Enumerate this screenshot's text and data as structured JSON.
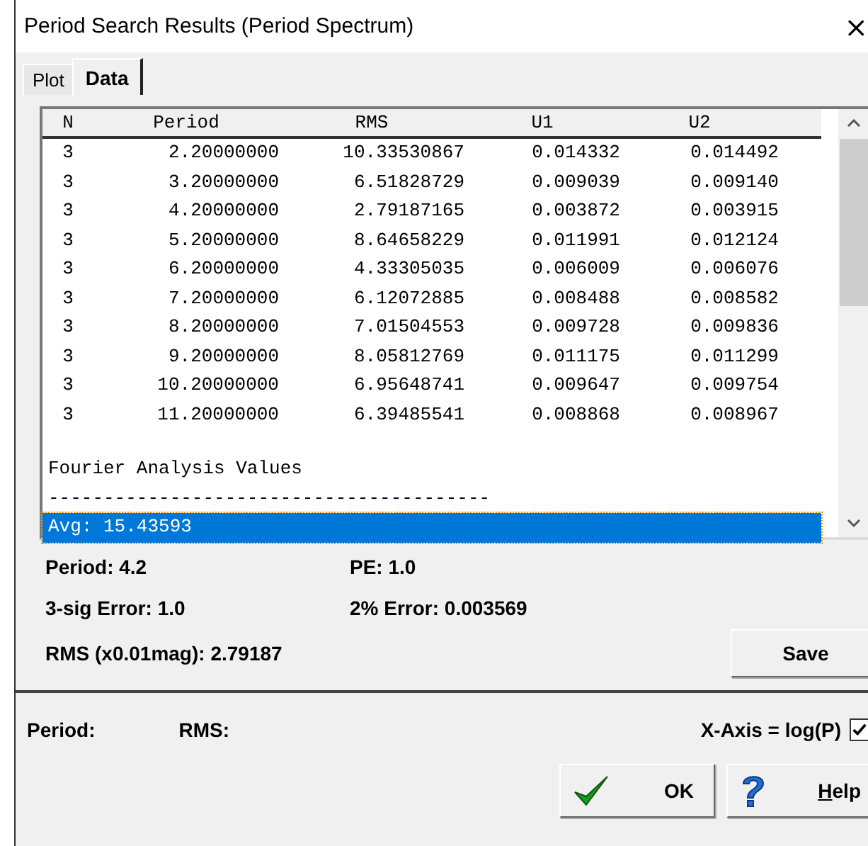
{
  "window": {
    "title": "Period Search Results (Period Spectrum)",
    "close": "×"
  },
  "tabs": [
    {
      "label": "Plot",
      "selected": false
    },
    {
      "label": "Data",
      "selected": true
    }
  ],
  "list": {
    "columns": [
      "N",
      "Period",
      "RMS",
      "U1",
      "U2"
    ],
    "lines": [
      {
        "kind": "row",
        "selected": false,
        "cells": [
          "3",
          "2.20000000",
          "10.33530867",
          "0.014332",
          "0.014492"
        ]
      },
      {
        "kind": "row",
        "selected": false,
        "cells": [
          "3",
          "3.20000000",
          "6.51828729",
          "0.009039",
          "0.009140"
        ]
      },
      {
        "kind": "row",
        "selected": false,
        "cells": [
          "3",
          "4.20000000",
          "2.79187165",
          "0.003872",
          "0.003915"
        ]
      },
      {
        "kind": "row",
        "selected": false,
        "cells": [
          "3",
          "5.20000000",
          "8.64658229",
          "0.011991",
          "0.012124"
        ]
      },
      {
        "kind": "row",
        "selected": false,
        "cells": [
          "3",
          "6.20000000",
          "4.33305035",
          "0.006009",
          "0.006076"
        ]
      },
      {
        "kind": "row",
        "selected": false,
        "cells": [
          "3",
          "7.20000000",
          "6.12072885",
          "0.008488",
          "0.008582"
        ]
      },
      {
        "kind": "row",
        "selected": false,
        "cells": [
          "3",
          "8.20000000",
          "7.01504553",
          "0.009728",
          "0.009836"
        ]
      },
      {
        "kind": "row",
        "selected": false,
        "cells": [
          "3",
          "9.20000000",
          "8.05812769",
          "0.011175",
          "0.011299"
        ]
      },
      {
        "kind": "row",
        "selected": false,
        "cells": [
          "3",
          "10.20000000",
          "6.95648741",
          "0.009647",
          "0.009754"
        ]
      },
      {
        "kind": "row",
        "selected": false,
        "cells": [
          "3",
          "11.20000000",
          "6.39485541",
          "0.008868",
          "0.008967"
        ]
      },
      {
        "kind": "heading",
        "selected": false,
        "text": "Fourier Analysis Values"
      },
      {
        "kind": "text",
        "selected": false,
        "text": "----------------------------------------"
      },
      {
        "kind": "text",
        "selected": true,
        "text": "Avg: 15.43593"
      }
    ]
  },
  "results": [
    [
      "Period: 4.2",
      "PE: 1.0"
    ],
    [
      "3-sig Error: 1.0",
      "2% Error: 0.003569"
    ],
    [
      "RMS (x0.01mag): 2.79187"
    ]
  ],
  "save_button": "Save",
  "status": {
    "period": "Period:",
    "rms": "RMS:",
    "x_axis_label": "X-Axis = log(P)",
    "x_axis_checked": true
  },
  "buttons": [
    {
      "kind": "ok",
      "label": "OK"
    },
    {
      "kind": "help",
      "label": "Help"
    }
  ]
}
